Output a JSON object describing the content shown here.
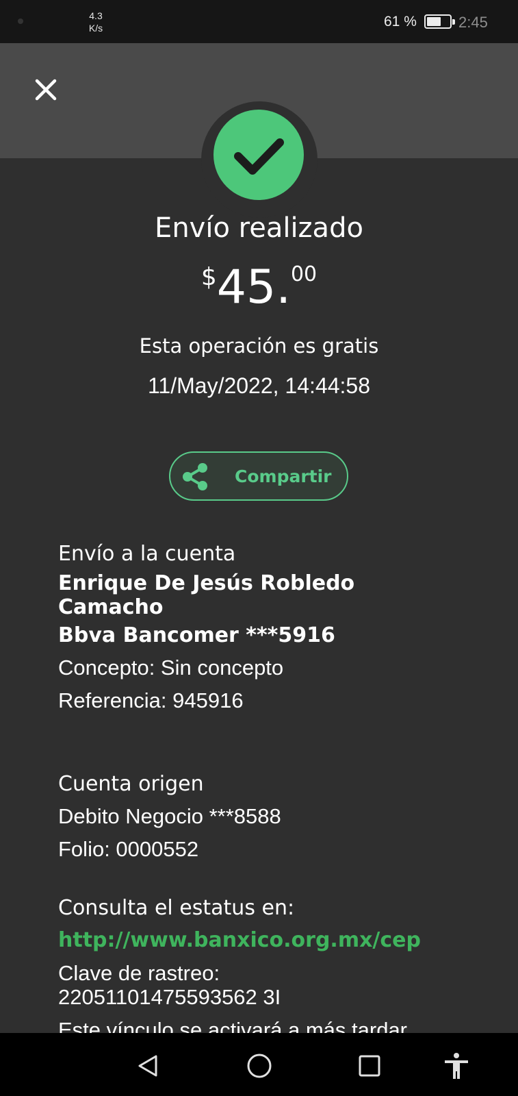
{
  "status_bar": {
    "net_speed": "4.3",
    "net_unit": "K/s",
    "battery": "61 %",
    "battery_level": 0.61,
    "time": "2:45"
  },
  "receipt": {
    "title": "Envío realizado",
    "amount_currency": "$",
    "amount_int": "45",
    "amount_sep": ".",
    "amount_cents": "00",
    "free_note": "Esta operación es gratis",
    "datetime": "11/May/2022, 14:44:58",
    "share_label": "Compartir"
  },
  "destination": {
    "heading": "Envío a la cuenta",
    "name_line1": "Enrique De Jesús Robledo",
    "name_line2": "Camacho",
    "bank": "Bbva Bancomer ***5916",
    "concept": "Concepto: Sin concepto",
    "reference": "Referencia: 945916"
  },
  "origin": {
    "heading": "Cuenta origen",
    "account": "Debito Negocio  ***8588",
    "folio": "Folio: 0000552"
  },
  "status": {
    "heading": "Consulta el estatus en:",
    "url": "http://www.banxico.org.mx/cep",
    "tracking_label": "Clave de rastreo:",
    "tracking_code": "22051101475593562 3I",
    "note": "Este vínculo se activará a más tardar"
  },
  "colors": {
    "success_green": "#4dc77a",
    "link_green": "#3fb45d",
    "background": "#2f2f2f",
    "header": "#4a4a4a"
  },
  "icons": [
    "close-icon",
    "check-icon",
    "share-icon",
    "back-icon",
    "home-icon",
    "recents-icon",
    "accessibility-icon"
  ]
}
